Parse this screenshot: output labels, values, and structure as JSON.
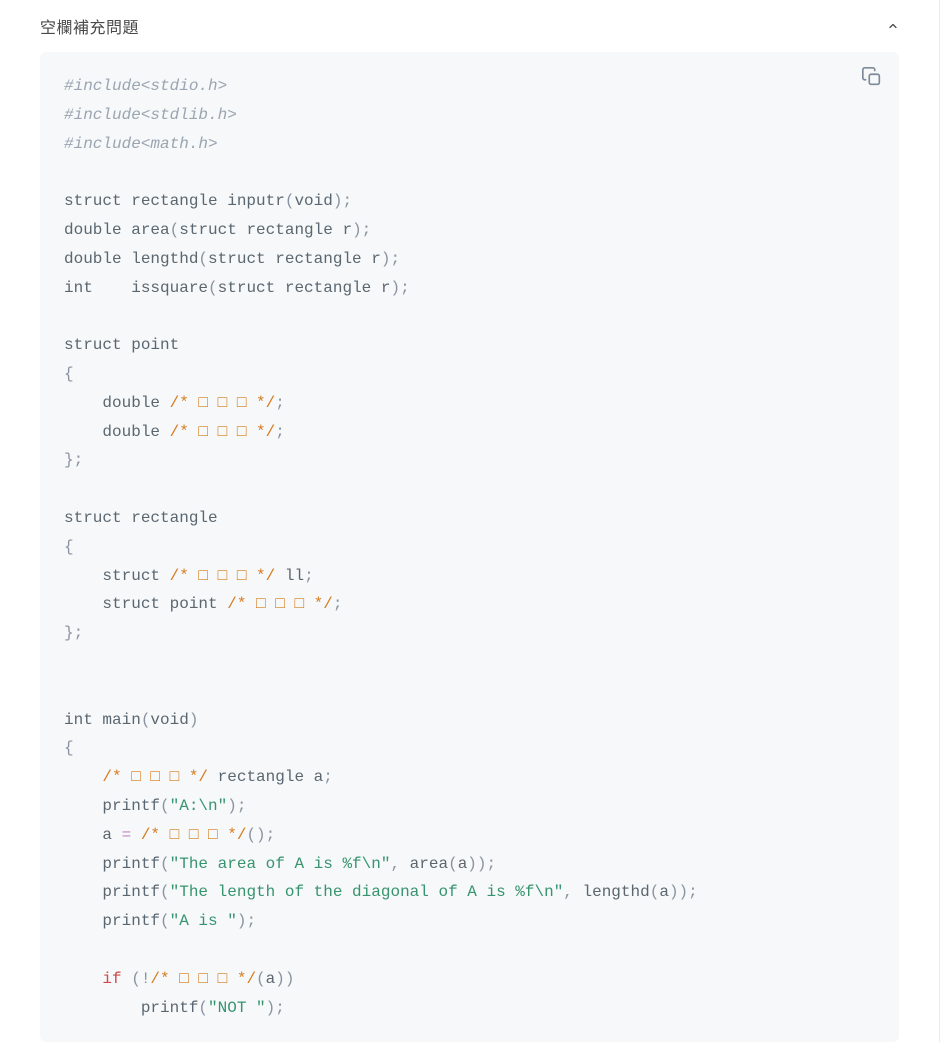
{
  "header": {
    "title": "空欄補充問題"
  },
  "code": {
    "l01": "#include<stdio.h>",
    "l02": "#include<stdlib.h>",
    "l03": "#include<math.h>",
    "blank_comment": "/* □ □ □ */",
    "decl1_a": "struct rectangle inputr",
    "decl1_b": "void",
    "decl2_a": "double area",
    "decl2_b": "struct rectangle r",
    "decl3_a": "double lengthd",
    "decl3_b": "struct rectangle r",
    "decl4_a": "int    issquare",
    "decl4_b": "struct rectangle r",
    "struct_point": "struct point",
    "brace_open": "{",
    "brace_close_semi": "};",
    "brace_close": "}",
    "indent": "    ",
    "indent2": "        ",
    "double_kw": "double ",
    "semi": ";",
    "struct_rect": "struct rectangle",
    "struct_kw": "struct ",
    "ll": " ll",
    "struct_point_kw": "struct point ",
    "int_main": "int main",
    "void": "void",
    "rect_a": " rectangle a",
    "printf": "printf",
    "str_A": "\"A:\\n\"",
    "a_eq": "a ",
    "eq": "=",
    "lparen": "(",
    "rparen": ")",
    "lparen_rparen_semi": "();",
    "str_area": "\"The area of A is %f\\n\"",
    "comma_sp": ", ",
    "area_a": "area",
    "a": "a",
    "str_diag": "\"The length of the diagonal of A is %f\\n\"",
    "lengthd": "lengthd",
    "str_Ais": "\"A is \"",
    "if": "if",
    "sp_paren_bang": " (!",
    "str_not": "\"NOT \""
  }
}
